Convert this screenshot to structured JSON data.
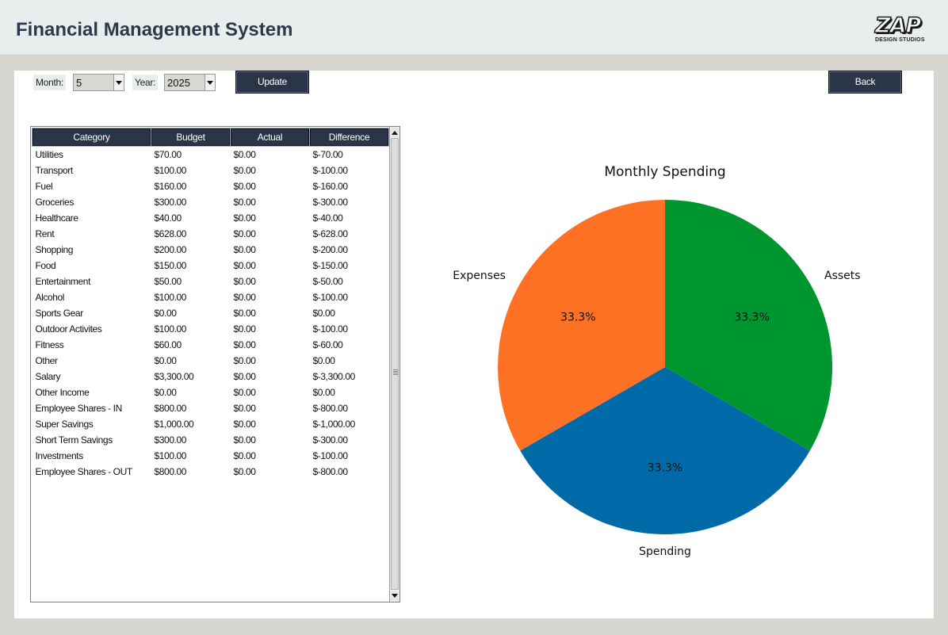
{
  "app": {
    "title": "Financial Management System"
  },
  "logo": {
    "main": "ZAP",
    "sub": "DESIGN STUDIOS"
  },
  "controls": {
    "month_label": "Month:",
    "month_value": "5",
    "year_label": "Year:",
    "year_value": "2025",
    "update_label": "Update",
    "back_label": "Back"
  },
  "table": {
    "columns": [
      "Category",
      "Budget",
      "Actual",
      "Difference"
    ],
    "rows": [
      [
        "Utilities",
        "$70.00",
        "$0.00",
        "$-70.00"
      ],
      [
        "Transport",
        "$100.00",
        "$0.00",
        "$-100.00"
      ],
      [
        "Fuel",
        "$160.00",
        "$0.00",
        "$-160.00"
      ],
      [
        "Groceries",
        "$300.00",
        "$0.00",
        "$-300.00"
      ],
      [
        "Healthcare",
        "$40.00",
        "$0.00",
        "$-40.00"
      ],
      [
        "Rent",
        "$628.00",
        "$0.00",
        "$-628.00"
      ],
      [
        "Shopping",
        "$200.00",
        "$0.00",
        "$-200.00"
      ],
      [
        "Food",
        "$150.00",
        "$0.00",
        "$-150.00"
      ],
      [
        "Entertainment",
        "$50.00",
        "$0.00",
        "$-50.00"
      ],
      [
        "Alcohol",
        "$100.00",
        "$0.00",
        "$-100.00"
      ],
      [
        "Sports Gear",
        "$0.00",
        "$0.00",
        "$0.00"
      ],
      [
        "Outdoor Activites",
        "$100.00",
        "$0.00",
        "$-100.00"
      ],
      [
        "Fitness",
        "$60.00",
        "$0.00",
        "$-60.00"
      ],
      [
        "Other",
        "$0.00",
        "$0.00",
        "$0.00"
      ],
      [
        "Salary",
        "$3,300.00",
        "$0.00",
        "$-3,300.00"
      ],
      [
        "Other Income",
        "$0.00",
        "$0.00",
        "$0.00"
      ],
      [
        "Employee Shares - IN",
        "$800.00",
        "$0.00",
        "$-800.00"
      ],
      [
        "Super Savings",
        "$1,000.00",
        "$0.00",
        "$-1,000.00"
      ],
      [
        "Short Term Savings",
        "$300.00",
        "$0.00",
        "$-300.00"
      ],
      [
        "Investments",
        "$100.00",
        "$0.00",
        "$-100.00"
      ],
      [
        "Employee Shares - OUT",
        "$800.00",
        "$0.00",
        "$-800.00"
      ]
    ]
  },
  "chart_data": {
    "type": "pie",
    "title": "Monthly Spending",
    "categories": [
      "Assets",
      "Spending",
      "Expenses"
    ],
    "values": [
      33.3,
      33.3,
      33.3
    ],
    "labels": [
      "33.3%",
      "33.3%",
      "33.3%"
    ],
    "colors": [
      "#00962f",
      "#006aa8",
      "#fe7125"
    ]
  }
}
